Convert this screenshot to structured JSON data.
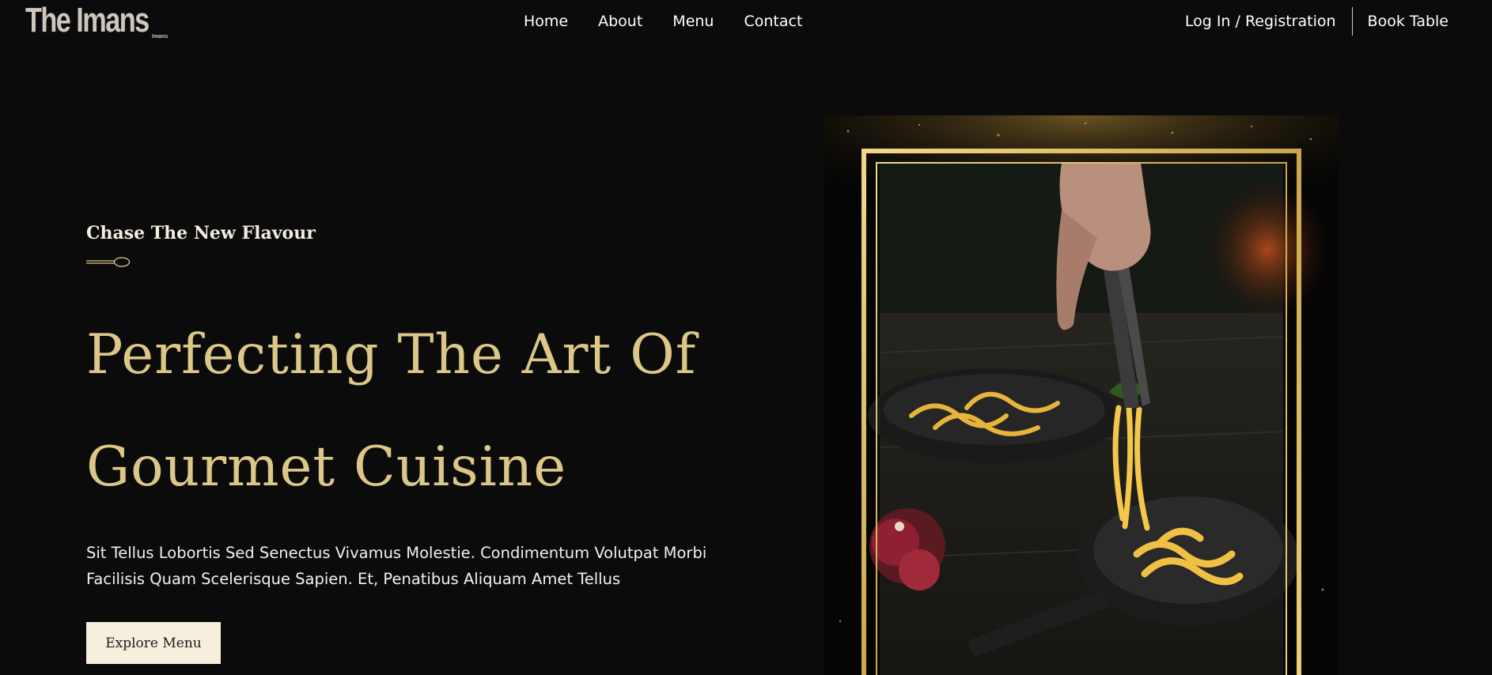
{
  "brand": {
    "name": "The Imans",
    "tagline": "Imans"
  },
  "nav": {
    "items": [
      "Home",
      "About",
      "Menu",
      "Contact"
    ],
    "login": "Log In / Registration",
    "book": "Book Table"
  },
  "hero": {
    "eyebrow": "Chase The New Flavour",
    "headline": [
      "Perfecting The Art Of",
      "Gourmet Cuisine"
    ],
    "description": [
      "Sit Tellus Lobortis Sed Senectus Vivamus Molestie. Condimentum Volutpat Morbi",
      "Facilisis Quam Scelerisque Sapien. Et, Penatibus Aliquam Amet Tellus"
    ],
    "cta": "Explore Menu"
  },
  "colors": {
    "background": "#0b0b0b",
    "gold": "#dcc788",
    "cream": "#f7efdd"
  }
}
